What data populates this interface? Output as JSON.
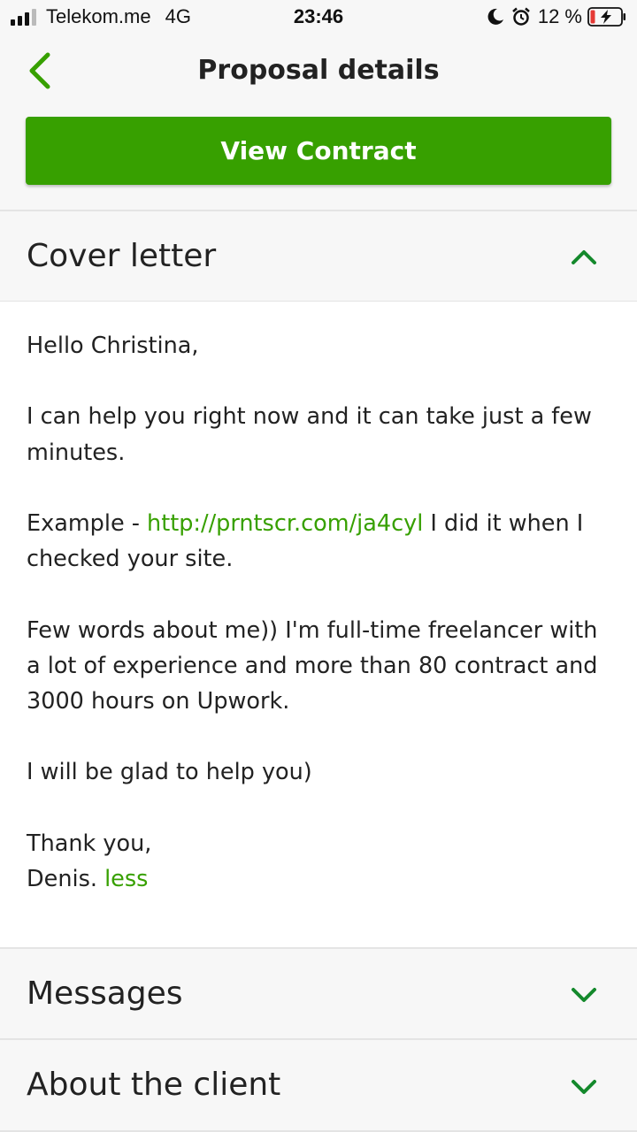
{
  "status_bar": {
    "carrier": "Telekom.me",
    "network": "4G",
    "time": "23:46",
    "battery": "12 %",
    "icons": [
      "signal-icon",
      "moon-icon",
      "alarm-icon",
      "battery-charging-icon"
    ]
  },
  "header": {
    "title": "Proposal details",
    "back_icon": "chevron-left-icon"
  },
  "actions": {
    "view_contract": "View Contract"
  },
  "colors": {
    "accent": "#37a000",
    "chevron": "#14892c"
  },
  "cover_letter": {
    "title": "Cover letter",
    "expanded": true,
    "greeting": "Hello Christina,",
    "p1": "I can help you right now and it can take just a few minutes.",
    "p2_prefix": "Example - ",
    "p2_link": "http://prntscr.com/ja4cyl",
    "p2_suffix": " I did it when I checked your site.",
    "p3": "Few words about me)) I'm full-time freelancer with a lot of experience and more than 80 contract and 3000 hours on Upwork.",
    "p4": "I will be glad to help you)",
    "signoff_1": "Thank you,",
    "signoff_2": "Denis. ",
    "less_link": "less"
  },
  "sections": {
    "messages": "Messages",
    "about_client": "About the client"
  }
}
